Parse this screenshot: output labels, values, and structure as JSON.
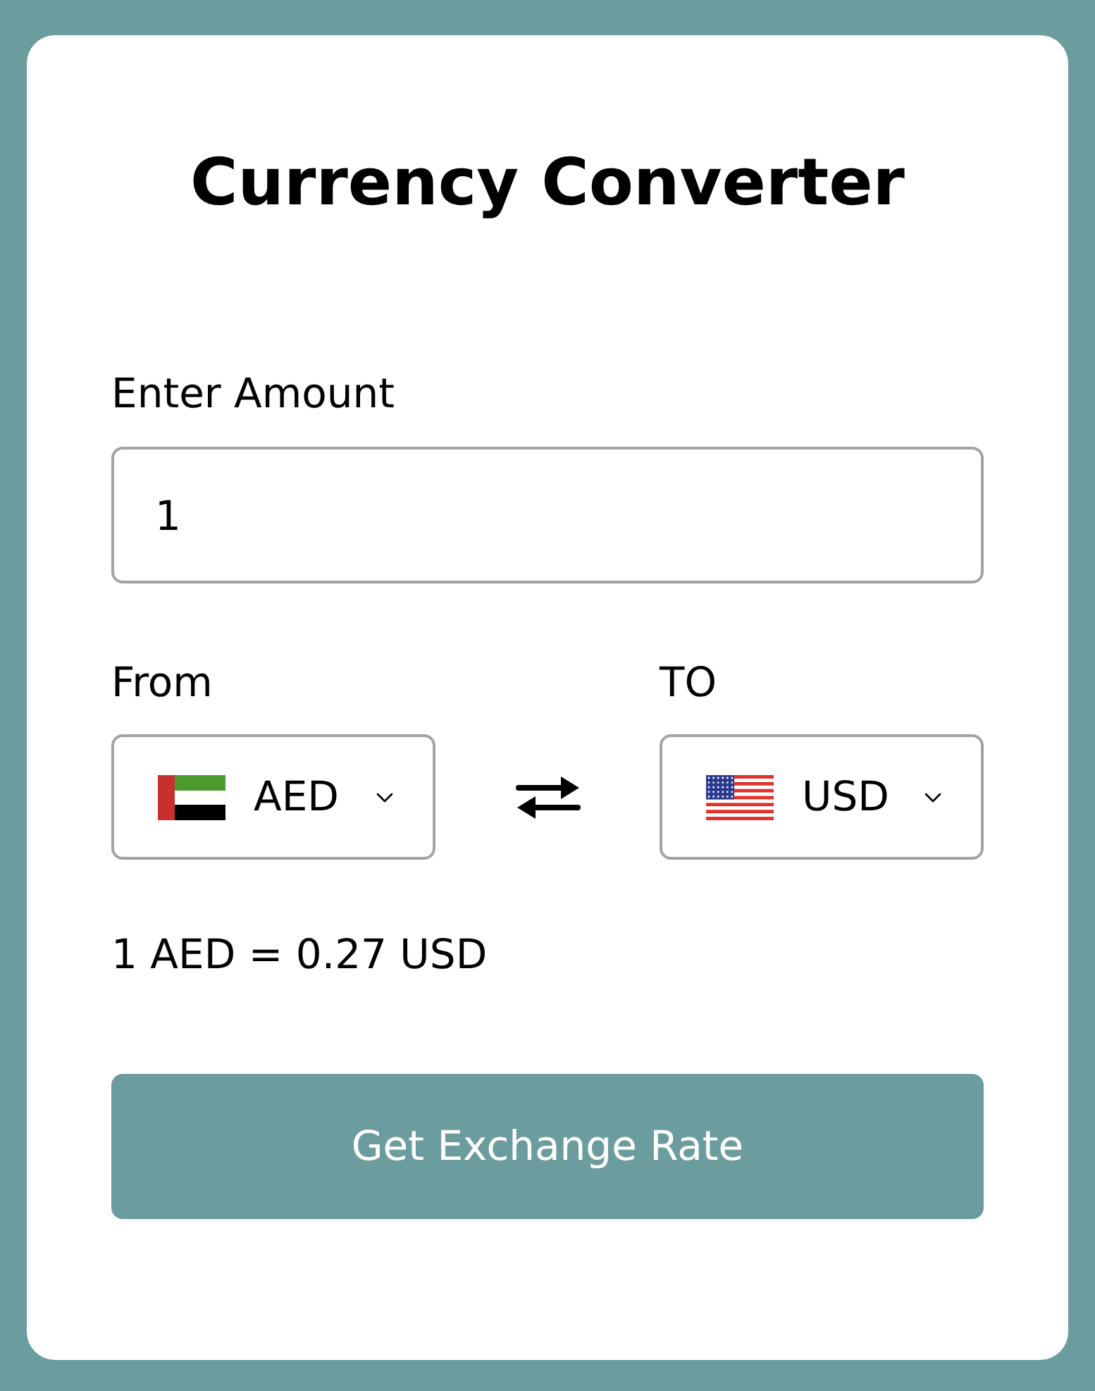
{
  "title": "Currency Converter",
  "amount": {
    "label": "Enter Amount",
    "value": "1"
  },
  "currencies": [
    {
      "label": "From",
      "code": "AED",
      "kind": "ae"
    },
    {
      "label": "TO",
      "code": "USD",
      "kind": "us"
    }
  ],
  "rate": "1 AED = 0.27 USD",
  "button": "Get Exchange Rate"
}
